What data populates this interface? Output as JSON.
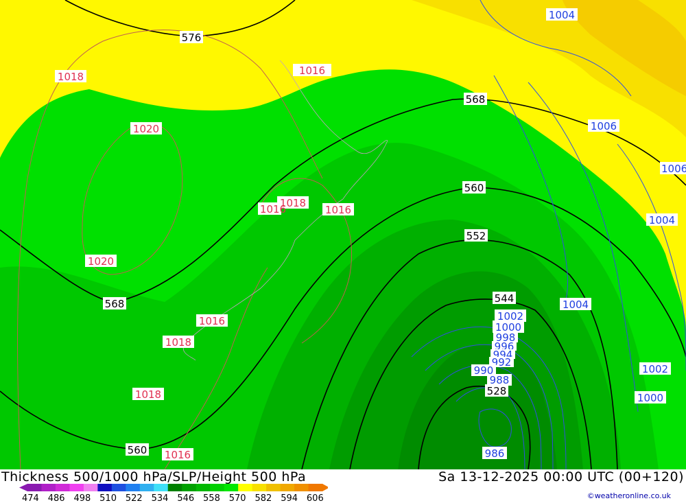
{
  "title": "Thickness 500/1000 hPa/SLP/Height 500 hPa",
  "valid_time": "Sa 13-12-2025 00:00 UTC (00+120)",
  "credit": "©weatheronline.co.uk",
  "colorbar": {
    "colors": [
      "#8a1bb0",
      "#b01fc8",
      "#d02ad8",
      "#f040f0",
      "#f080f0",
      "#1010c0",
      "#1e50e0",
      "#2080f0",
      "#30b0f0",
      "#40e0f8",
      "#008000",
      "#00a000",
      "#00b800",
      "#00d000",
      "#00e800",
      "#ffff00",
      "#f8e000",
      "#f0c000",
      "#f0a800",
      "#f09000",
      "#f07800"
    ],
    "ticks": [
      "474",
      "486",
      "498",
      "510",
      "522",
      "534",
      "546",
      "558",
      "570",
      "582",
      "594",
      "606"
    ]
  },
  "contours": {
    "height_500": [
      {
        "text": "576"
      },
      {
        "text": "568"
      },
      {
        "text": "568"
      },
      {
        "text": "560"
      },
      {
        "text": "560"
      },
      {
        "text": "552"
      },
      {
        "text": "544"
      },
      {
        "text": "528"
      }
    ],
    "slp_red": [
      {
        "text": "1018"
      },
      {
        "text": "1016"
      },
      {
        "text": "1020"
      },
      {
        "text": "1018"
      },
      {
        "text": "1016"
      },
      {
        "text": "1016"
      },
      {
        "text": "1020"
      },
      {
        "text": "1016"
      },
      {
        "text": "1018"
      },
      {
        "text": "1018"
      },
      {
        "text": "1016"
      }
    ],
    "slp_blue": [
      {
        "text": "1004"
      },
      {
        "text": "1006"
      },
      {
        "text": "1006"
      },
      {
        "text": "1004"
      },
      {
        "text": "1004"
      },
      {
        "text": "1002"
      },
      {
        "text": "1000"
      },
      {
        "text": "998"
      },
      {
        "text": "996"
      },
      {
        "text": "994"
      },
      {
        "text": "992"
      },
      {
        "text": "990"
      },
      {
        "text": "988"
      },
      {
        "text": "1002"
      },
      {
        "text": "1000"
      },
      {
        "text": "986"
      }
    ]
  }
}
